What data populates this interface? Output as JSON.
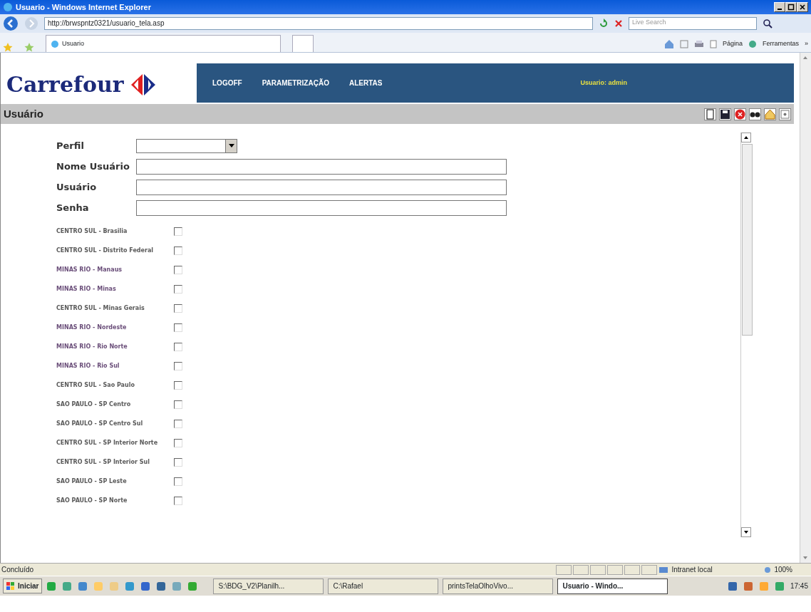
{
  "window": {
    "title": "Usuario - Windows Internet Explorer"
  },
  "address_bar": {
    "url": "http://brwspntz0321/usuario_tela.asp",
    "search_placeholder": "Live Search"
  },
  "tab": {
    "label": "Usuario"
  },
  "command_bar": [
    "Página",
    "Ferramentas",
    "»"
  ],
  "header": {
    "logo": "Carrefour",
    "menu": [
      "LOGOFF",
      "PARAMETRIZAÇÃO",
      "ALERTAS"
    ],
    "user": "Usuario: admin"
  },
  "page_title": "Usuário",
  "form": {
    "fields": [
      {
        "label": "Perfil",
        "kind": "select"
      },
      {
        "label": "Nome Usuário",
        "kind": "text"
      },
      {
        "label": "Usuário",
        "kind": "text"
      },
      {
        "label": "Senha",
        "kind": "text"
      }
    ]
  },
  "regions": [
    {
      "label": "CENTRO SUL - Brasilia",
      "checked": false,
      "color": "#5a5a5a"
    },
    {
      "label": "CENTRO SUL - Distrito Federal",
      "checked": false,
      "color": "#5a5a5a"
    },
    {
      "label": "MINAS RIO - Manaus",
      "checked": false,
      "color": "#6b4f7a"
    },
    {
      "label": "MINAS RIO - Minas",
      "checked": false,
      "color": "#6b4f7a"
    },
    {
      "label": "CENTRO SUL - Minas Gerais",
      "checked": false,
      "color": "#5a5a5a"
    },
    {
      "label": "MINAS RIO - Nordeste",
      "checked": false,
      "color": "#6b4f7a"
    },
    {
      "label": "MINAS RIO - Rio Norte",
      "checked": false,
      "color": "#6b4f7a"
    },
    {
      "label": "MINAS RIO - Rio Sul",
      "checked": false,
      "color": "#6b4f7a"
    },
    {
      "label": "CENTRO SUL - Sao Paulo",
      "checked": false,
      "color": "#5a5a5a"
    },
    {
      "label": "SAO PAULO - SP Centro",
      "checked": false,
      "color": "#5a5a5a"
    },
    {
      "label": "SAO PAULO - SP Centro Sul",
      "checked": false,
      "color": "#5a5a5a"
    },
    {
      "label": "CENTRO SUL - SP Interior Norte",
      "checked": false,
      "color": "#5a5a5a"
    },
    {
      "label": "CENTRO SUL - SP Interior Sul",
      "checked": false,
      "color": "#5a5a5a"
    },
    {
      "label": "SAO PAULO - SP Leste",
      "checked": false,
      "color": "#5a5a5a"
    },
    {
      "label": "SAO PAULO - SP Norte",
      "checked": false,
      "color": "#5a5a5a"
    }
  ],
  "status_bar": {
    "text": "Concluído",
    "zone": "Intranet local",
    "zoom": "100%"
  },
  "taskbar": {
    "start": "Iniciar",
    "items": [
      {
        "label": "S:\\BDG_V2\\Planilh...",
        "selected": false
      },
      {
        "label": "C:\\Rafael",
        "selected": false
      },
      {
        "label": "printsTelaOlhoVivo...",
        "selected": false
      },
      {
        "label": "Usuario - Windo...",
        "selected": true
      }
    ],
    "clock": "17:45"
  }
}
